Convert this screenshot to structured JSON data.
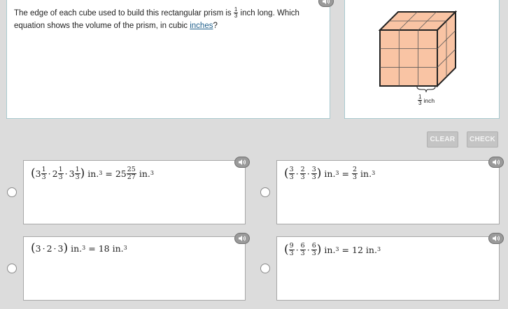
{
  "question": {
    "text_before": "The edge of each cube used to build this rectangular prism is",
    "edge_fraction": {
      "num": "1",
      "den": "3"
    },
    "text_middle": "inch long. Which equation shows the volume of the prism, in cubic",
    "link_text": "inches",
    "text_end": "?"
  },
  "figure": {
    "label_fraction": {
      "num": "1",
      "den": "3"
    },
    "label_unit": "inch",
    "cube_color": "#f9c4a4"
  },
  "toolbar": {
    "clear_label": "CLEAR",
    "check_label": "CHECK"
  },
  "choices": [
    {
      "factors": [
        {
          "whole": "3",
          "num": "1",
          "den": "3"
        },
        {
          "whole": "2",
          "num": "1",
          "den": "3"
        },
        {
          "whole": "3",
          "num": "1",
          "den": "3"
        }
      ],
      "unit": "in.",
      "exp": "3",
      "equals": "=",
      "result": {
        "whole": "25",
        "num": "25",
        "den": "27"
      },
      "result_unit": "in.",
      "result_exp": "3"
    },
    {
      "factors": [
        {
          "whole": "",
          "num": "3",
          "den": "3"
        },
        {
          "whole": "",
          "num": "2",
          "den": "3"
        },
        {
          "whole": "",
          "num": "3",
          "den": "3"
        }
      ],
      "unit": "in.",
      "exp": "3",
      "equals": "=",
      "result": {
        "whole": "",
        "num": "2",
        "den": "3"
      },
      "result_unit": "in.",
      "result_exp": "3"
    },
    {
      "factors": [
        {
          "whole": "3",
          "num": "",
          "den": ""
        },
        {
          "whole": "2",
          "num": "",
          "den": ""
        },
        {
          "whole": "3",
          "num": "",
          "den": ""
        }
      ],
      "unit": "in.",
      "exp": "3",
      "equals": "=",
      "result": {
        "whole": "18",
        "num": "",
        "den": ""
      },
      "result_unit": "in.",
      "result_exp": "3"
    },
    {
      "factors": [
        {
          "whole": "",
          "num": "9",
          "den": "3"
        },
        {
          "whole": "",
          "num": "6",
          "den": "3"
        },
        {
          "whole": "",
          "num": "6",
          "den": "3"
        }
      ],
      "unit": "in.",
      "exp": "3",
      "equals": "=",
      "result": {
        "whole": "12",
        "num": "",
        "den": ""
      },
      "result_unit": "in.",
      "result_exp": "3"
    }
  ],
  "icons": {
    "audio": "speaker-icon"
  }
}
